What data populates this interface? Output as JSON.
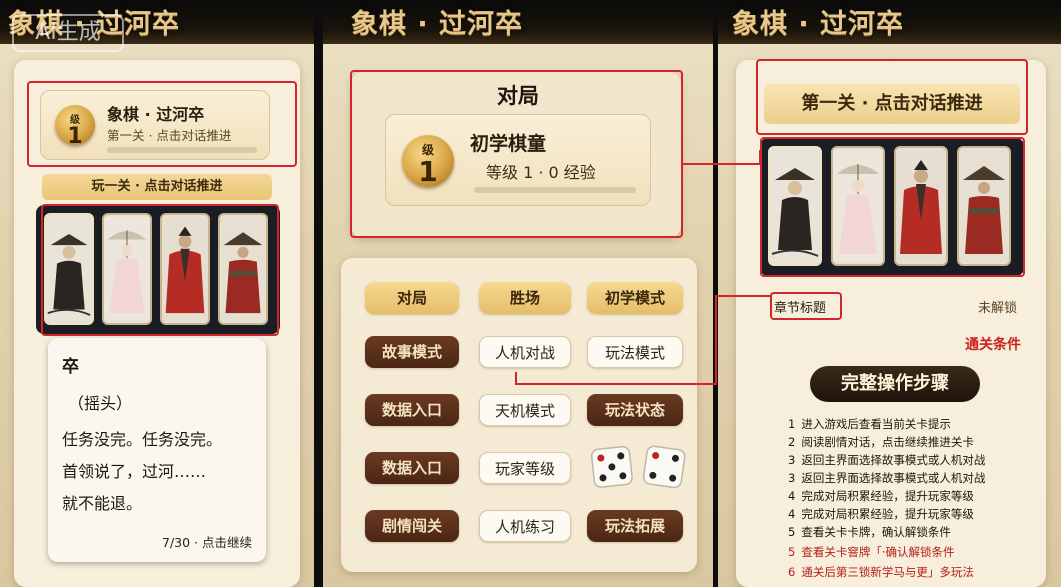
{
  "watermark": "AI生成",
  "panel1": {
    "title": "象棋 · 过河卒",
    "card": {
      "level_label": "级",
      "level_value": "1",
      "name": "象棋 · 过河卒",
      "subtitle": "第一关 · 点击对话推进",
      "progress": 0
    },
    "strip": "玩一关 · 点击对话推进",
    "characters": [
      "bamboo-hat-elder",
      "umbrella-lady",
      "red-robed-scholar",
      "bamboo-hat-warrior"
    ],
    "dialog": {
      "speaker": "卒",
      "action": "（摇头）",
      "line1": "任务没完。任务没完。",
      "line2": "首领说了，过河……",
      "line3": "就不能退。",
      "footer": "7/30 · 点击继续"
    }
  },
  "panel2": {
    "title": "象棋 · 过河卒",
    "heading": "对局",
    "card": {
      "level_label": "级",
      "level_value": "1",
      "rank": "初学棋童",
      "exp": "等级 1 · 0 经验",
      "progress": 0
    },
    "buttons": [
      {
        "label": "对局",
        "style": "gold"
      },
      {
        "label": "胜场",
        "style": "gold"
      },
      {
        "label": "初学模式",
        "style": "gold"
      },
      {
        "label": "故事模式",
        "style": "brown"
      },
      {
        "label": "人机对战",
        "style": "white"
      },
      {
        "label": "玩法模式",
        "style": "white"
      },
      {
        "label": "数据入口",
        "style": "brown"
      },
      {
        "label": "天机模式",
        "style": "white"
      },
      {
        "label": "玩法状态",
        "style": "brown"
      },
      {
        "label": "数据入口",
        "style": "brown"
      },
      {
        "label": "玩家等级",
        "style": "white"
      },
      {
        "label": "剧情闯关",
        "style": "brown"
      },
      {
        "label": "人机练习",
        "style": "white"
      },
      {
        "label": "玩法拓展",
        "style": "brown"
      }
    ],
    "dice": [
      5,
      4
    ]
  },
  "panel3": {
    "title": "象棋 · 过河卒",
    "stage_title": "第一关 · 点击对话推进",
    "characters": [
      "bamboo-hat-elder",
      "umbrella-lady",
      "red-robed-scholar",
      "bamboo-hat-warrior"
    ],
    "chapter_label": "章节标题",
    "locked": "未解锁",
    "clear_condition": "通关条件",
    "steps_heading": "完整操作步骤",
    "steps": [
      {
        "num": "1",
        "text": "进入游戏后查看当前关卡提示"
      },
      {
        "num": "2",
        "text": "阅读剧情对话，点击继续推进关卡"
      },
      {
        "num": "3",
        "text": "返回主界面选择故事模式或人机对战"
      },
      {
        "num": "3",
        "text": "返回主界面选择故事模式或人机对战"
      },
      {
        "num": "4",
        "text": "完成对局积累经验，提升玩家等级"
      },
      {
        "num": "4",
        "text": "完成对局积累经验，提升玩家等级"
      },
      {
        "num": "5",
        "text": "查看关卡卡牌，确认解锁条件"
      },
      {
        "num": "5",
        "text": "查看关卡窨牌「·确认解锁条件"
      },
      {
        "num": "6",
        "text": "通关后第三锁新学马与更」多玩法"
      }
    ]
  },
  "colors": {
    "accent_red": "#d3262c",
    "gold": "#e5bd6a",
    "brown": "#4b2614",
    "title_gold": "#e8c88a"
  }
}
